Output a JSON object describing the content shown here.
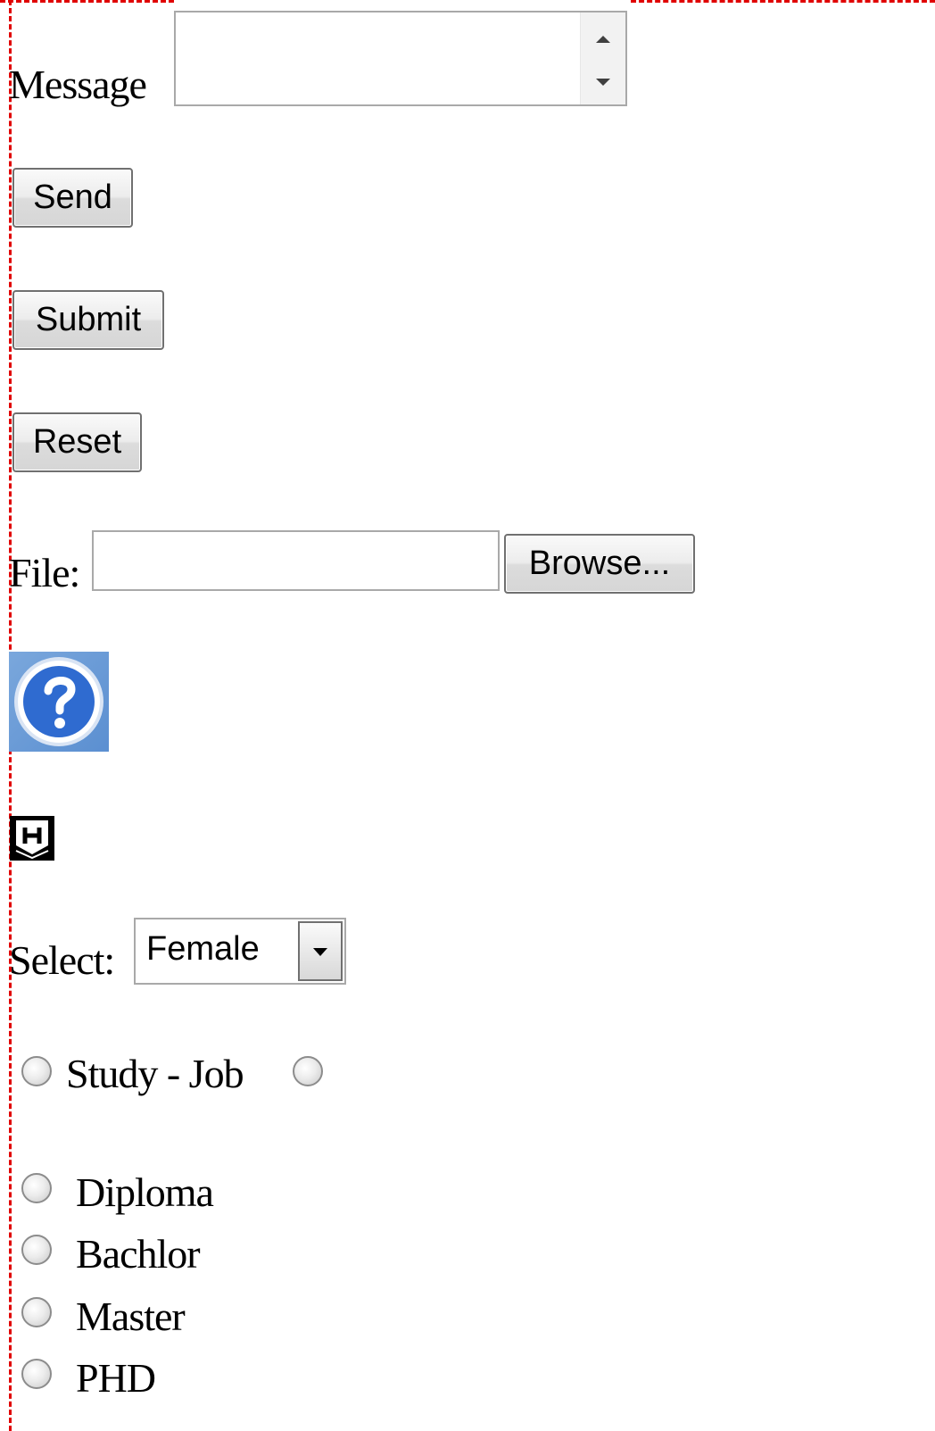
{
  "message": {
    "label": "Message",
    "value": ""
  },
  "buttons": {
    "send": "Send",
    "submit": "Submit",
    "reset": "Reset"
  },
  "file": {
    "label": "File:",
    "value": "",
    "browse": "Browse..."
  },
  "icons": {
    "help": "help-question-icon",
    "header": "h-shield-icon"
  },
  "select": {
    "label": "Select:",
    "selected": "Female"
  },
  "radio_group_1": {
    "label": "Study - Job"
  },
  "education": {
    "options": [
      "Diploma",
      "Bachlor",
      "Master",
      "PHD"
    ]
  },
  "colors": {
    "frame": "#e00000",
    "help_icon_blue": "#2f6bd0"
  }
}
